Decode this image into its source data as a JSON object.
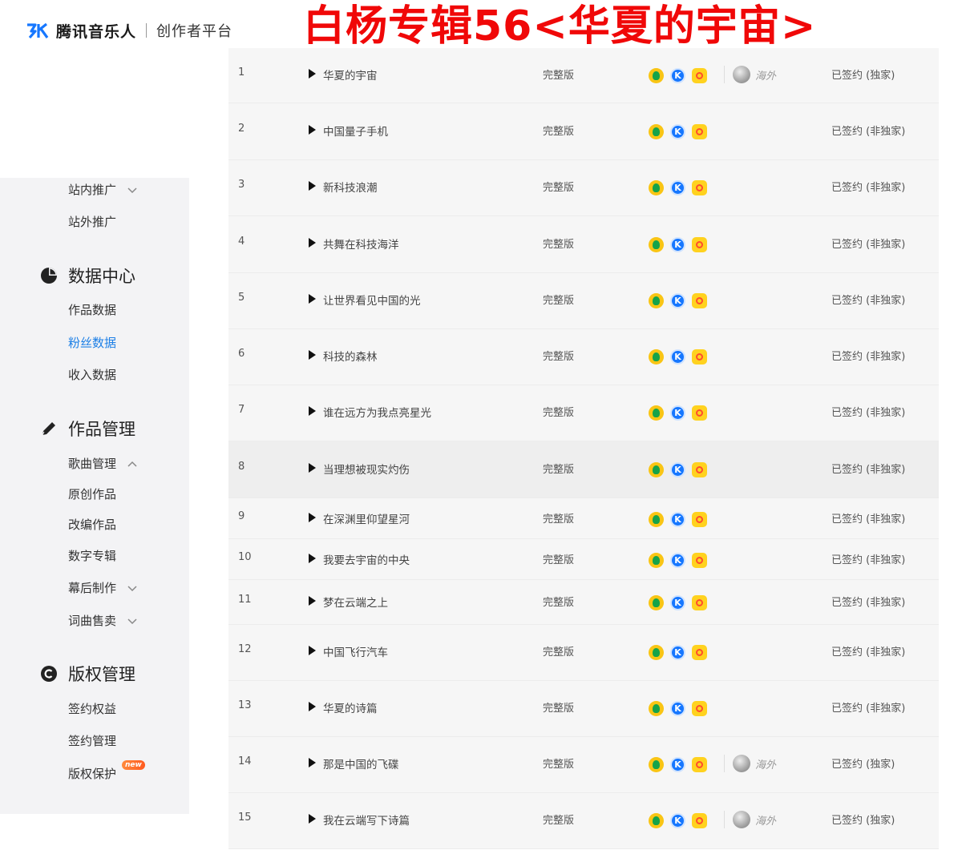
{
  "header": {
    "logo_text": "腾讯音乐人",
    "logo_sub": "创作者平台",
    "album_title": "白杨专辑56<华夏的宇宙>"
  },
  "sidebar": {
    "promo_items": [
      {
        "label": "站内推广",
        "has_chevron": true,
        "chevron": "down"
      },
      {
        "label": "站外推广",
        "has_chevron": false
      }
    ],
    "sections": [
      {
        "title": "数据中心",
        "icon": "pie-chart-icon",
        "items": [
          {
            "label": "作品数据"
          },
          {
            "label": "粉丝数据",
            "active": true
          },
          {
            "label": "收入数据"
          }
        ]
      },
      {
        "title": "作品管理",
        "icon": "pencil-icon",
        "items": [
          {
            "label": "歌曲管理",
            "chevron": "up"
          },
          {
            "label": "原创作品"
          },
          {
            "label": "改编作品"
          },
          {
            "label": "数字专辑"
          },
          {
            "label": "幕后制作",
            "chevron": "down"
          },
          {
            "label": "词曲售卖",
            "chevron": "down"
          }
        ]
      },
      {
        "title": "版权管理",
        "icon": "copyright-icon",
        "items": [
          {
            "label": "签约权益"
          },
          {
            "label": "签约管理"
          },
          {
            "label": "版权保护",
            "badge": "new"
          }
        ]
      }
    ]
  },
  "platform_icons": [
    "qq-music-icon",
    "kugou-icon",
    "kuwo-icon"
  ],
  "overseas_label": "海外",
  "songs": [
    {
      "no": "1",
      "title": "华夏的宇宙",
      "version": "完整版",
      "overseas": true,
      "sign": "已签约 (独家)"
    },
    {
      "no": "2",
      "title": "中国量子手机",
      "version": "完整版",
      "overseas": false,
      "sign": "已签约 (非独家)"
    },
    {
      "no": "3",
      "title": "新科技浪潮",
      "version": "完整版",
      "overseas": false,
      "sign": "已签约 (非独家)"
    },
    {
      "no": "4",
      "title": "共舞在科技海洋",
      "version": "完整版",
      "overseas": false,
      "sign": "已签约 (非独家)"
    },
    {
      "no": "5",
      "title": "让世界看见中国的光",
      "version": "完整版",
      "overseas": false,
      "sign": "已签约 (非独家)"
    },
    {
      "no": "6",
      "title": "科技的森林",
      "version": "完整版",
      "overseas": false,
      "sign": "已签约 (非独家)"
    },
    {
      "no": "7",
      "title": "谁在远方为我点亮星光",
      "version": "完整版",
      "overseas": false,
      "sign": "已签约 (非独家)"
    },
    {
      "no": "8",
      "title": "当理想被现实灼伤",
      "version": "完整版",
      "overseas": false,
      "sign": "已签约 (非独家)"
    },
    {
      "no": "9",
      "title": "在深渊里仰望星河",
      "version": "完整版",
      "overseas": false,
      "sign": "已签约 (非独家)"
    },
    {
      "no": "10",
      "title": "我要去宇宙的中央",
      "version": "完整版",
      "overseas": false,
      "sign": "已签约 (非独家)"
    },
    {
      "no": "11",
      "title": "梦在云端之上",
      "version": "完整版",
      "overseas": false,
      "sign": "已签约 (非独家)"
    },
    {
      "no": "12",
      "title": "中国飞行汽车",
      "version": "完整版",
      "overseas": false,
      "sign": "已签约 (非独家)"
    },
    {
      "no": "13",
      "title": "华夏的诗篇",
      "version": "完整版",
      "overseas": false,
      "sign": "已签约 (非独家)"
    },
    {
      "no": "14",
      "title": "那是中国的飞碟",
      "version": "完整版",
      "overseas": true,
      "sign": "已签约 (独家)"
    },
    {
      "no": "15",
      "title": "我在云端写下诗篇",
      "version": "完整版",
      "overseas": true,
      "sign": "已签约 (独家)"
    }
  ]
}
